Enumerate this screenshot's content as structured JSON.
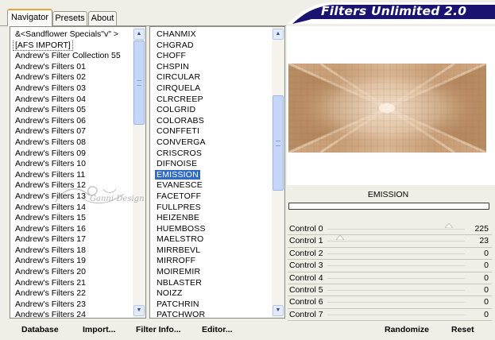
{
  "tabs": [
    {
      "label": "Navigator",
      "active": true
    },
    {
      "label": "Presets",
      "active": false
    },
    {
      "label": "About",
      "active": false
    }
  ],
  "title": "Filters Unlimited 2.0",
  "categories": {
    "items": [
      "&<Sandflower Specials\"v\" >",
      "[AFS IMPORT]",
      "Andrew's Filter Collection 55",
      "Andrew's Filters 01",
      "Andrew's Filters 02",
      "Andrew's Filters 03",
      "Andrew's Filters 04",
      "Andrew's Filters 05",
      "Andrew's Filters 06",
      "Andrew's Filters 07",
      "Andrew's Filters 08",
      "Andrew's Filters 09",
      "Andrew's Filters 10",
      "Andrew's Filters 11",
      "Andrew's Filters 12",
      "Andrew's Filters 13",
      "Andrew's Filters 14",
      "Andrew's Filters 15",
      "Andrew's Filters 16",
      "Andrew's Filters 17",
      "Andrew's Filters 18",
      "Andrew's Filters 19",
      "Andrew's Filters 20",
      "Andrew's Filters 21",
      "Andrew's Filters 22",
      "Andrew's Filters 23",
      "Andrew's Filters 24"
    ],
    "focused_index": 1
  },
  "filters": {
    "items": [
      "CHANMIX",
      "CHGRAD",
      "CHOFF",
      "CHSPIN",
      "CIRCULAR",
      "CIRQUELA",
      "CLRCREEP",
      "COLGRID",
      "COLORABS",
      "CONFFETI",
      "CONVERGA",
      "CRISCROS",
      "DIFNOISE",
      "EMISSION",
      "EVANESCE",
      "FACETOFF",
      "FULLPRES",
      "HEIZENBE",
      "HUEMBOSS",
      "MAELSTRO",
      "MIRRBEVL",
      "MIRROFF",
      "MOIREMIR",
      "NBLASTER",
      "NOIZZ",
      "PATCHRIN",
      "PATCHWOR"
    ],
    "selected_index": 13
  },
  "watermark_text": "Ganni-Design",
  "preview": {
    "filter_name": "EMISSION",
    "progress_percent": 0
  },
  "controls": [
    {
      "label": "Control 0",
      "value": "225"
    },
    {
      "label": "Control 1",
      "value": "23"
    },
    {
      "label": "Control 2",
      "value": "0"
    },
    {
      "label": "Control 3",
      "value": "0"
    },
    {
      "label": "Control 4",
      "value": "0"
    },
    {
      "label": "Control 5",
      "value": "0"
    },
    {
      "label": "Control 6",
      "value": "0"
    },
    {
      "label": "Control 7",
      "value": "0"
    }
  ],
  "buttons": {
    "database": "Database",
    "import": "Import...",
    "filter_info": "Filter Info...",
    "editor": "Editor...",
    "randomize": "Randomize",
    "reset": "Reset"
  },
  "colors": {
    "banner": "#1a1470",
    "selection": "#316ac5",
    "tab_accent": "#e8a33a",
    "preview_warm": "#c49468",
    "preview_light": "#efd9c2"
  }
}
